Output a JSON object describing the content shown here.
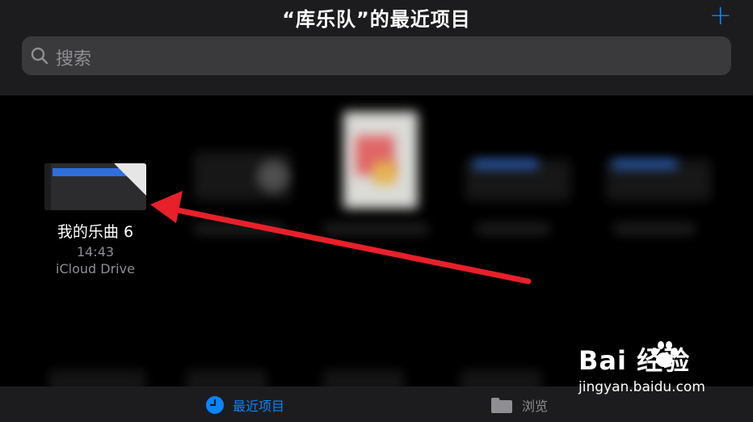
{
  "header": {
    "title": "“库乐队”的最近项目",
    "add_label": "+"
  },
  "search": {
    "placeholder": "搜索"
  },
  "file": {
    "name": "我的乐曲 6",
    "time": "14:43",
    "location": "iCloud Drive"
  },
  "tabs": [
    {
      "label": "最近项目",
      "active": true,
      "icon": "clock-icon"
    },
    {
      "label": "浏览",
      "active": false,
      "icon": "folder-icon"
    }
  ],
  "watermark": {
    "logo": "Bai  经验",
    "url": "jingyan.baidu.com"
  },
  "colors": {
    "accent": "#0a84ff",
    "arrow": "#e8202a"
  }
}
